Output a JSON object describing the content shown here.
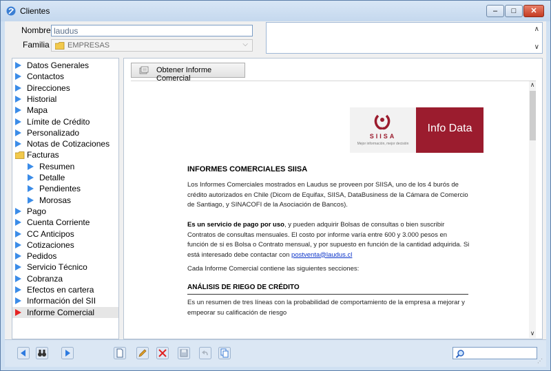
{
  "window": {
    "title": "Clientes"
  },
  "form": {
    "nombre_label": "Nombre",
    "nombre_value": "laudus",
    "familia_label": "Familia",
    "familia_value": "EMPRESAS"
  },
  "tree": {
    "items": [
      {
        "label": "Datos Generales",
        "level": 0,
        "icon": "blue-triangle-icon"
      },
      {
        "label": "Contactos",
        "level": 0,
        "icon": "blue-triangle-icon"
      },
      {
        "label": "Direcciones",
        "level": 0,
        "icon": "blue-triangle-icon"
      },
      {
        "label": "Historial",
        "level": 0,
        "icon": "blue-triangle-icon"
      },
      {
        "label": "Mapa",
        "level": 0,
        "icon": "blue-triangle-icon"
      },
      {
        "label": "Límite de Crédito",
        "level": 0,
        "icon": "blue-triangle-icon"
      },
      {
        "label": "Personalizado",
        "level": 0,
        "icon": "blue-triangle-icon"
      },
      {
        "label": "Notas de Cotizaciones",
        "level": 0,
        "icon": "blue-triangle-icon"
      },
      {
        "label": "Facturas",
        "level": 0,
        "icon": "folder-icon"
      },
      {
        "label": "Resumen",
        "level": 1,
        "icon": "blue-triangle-icon"
      },
      {
        "label": "Detalle",
        "level": 1,
        "icon": "blue-triangle-icon"
      },
      {
        "label": "Pendientes",
        "level": 1,
        "icon": "blue-triangle-icon"
      },
      {
        "label": "Morosas",
        "level": 1,
        "icon": "blue-triangle-icon"
      },
      {
        "label": "Pago",
        "level": 0,
        "icon": "blue-triangle-icon"
      },
      {
        "label": "Cuenta Corriente",
        "level": 0,
        "icon": "blue-triangle-icon"
      },
      {
        "label": "CC Anticipos",
        "level": 0,
        "icon": "blue-triangle-icon"
      },
      {
        "label": "Cotizaciones",
        "level": 0,
        "icon": "blue-triangle-icon"
      },
      {
        "label": "Pedidos",
        "level": 0,
        "icon": "blue-triangle-icon"
      },
      {
        "label": "Servicio Técnico",
        "level": 0,
        "icon": "blue-triangle-icon"
      },
      {
        "label": "Cobranza",
        "level": 0,
        "icon": "blue-triangle-icon"
      },
      {
        "label": "Efectos en cartera",
        "level": 0,
        "icon": "blue-triangle-icon"
      },
      {
        "label": "Información del SII",
        "level": 0,
        "icon": "blue-triangle-icon"
      },
      {
        "label": "Informe Comercial",
        "level": 0,
        "icon": "red-triangle-icon",
        "selected": true
      }
    ]
  },
  "panel": {
    "button_label": "Obtener Informe Comercial"
  },
  "document": {
    "logo_brand": "SIISA",
    "logo_tagline": "Mejor información, mejor decisión",
    "logo_right": "Info Data",
    "heading": "INFORMES COMERCIALES SIISA",
    "para1": "Los Informes Comerciales mostrados en Laudus se proveen por SIISA, uno de los 4 burós de crédito autorizados en Chile (Dicom de Equifax, SIISA, DataBusiness de la Cámara de Comercio de Santiago, y SINACOFI de la Asociación de Bancos).",
    "para2_bold": "Es un servicio de pago por uso",
    "para2_rest": ", y pueden adquirir Bolsas de consultas o bien suscribir Contratos de consultas mensuales. El costo por informe varía entre 600 y 3.000 pesos en función de si es Bolsa o Contrato mensual, y por supuesto en función de la cantidad adquirida. Si está interesado debe contactar con ",
    "para2_link": "postventa@laudus.cl",
    "para3": "Cada Informe Comercial contiene las siguientes secciones:",
    "section_heading": "ANÁLISIS DE RIEGO DE CRÉDITO",
    "para4": "Es un resumen de tres líneas con la probabilidad de comportamiento de la empresa a mejorar y empeorar su calificación de riesgo"
  },
  "colors": {
    "accent_blue": "#3b8ce8",
    "selected_red": "#e52424",
    "brand_red": "#9b1c2e"
  }
}
